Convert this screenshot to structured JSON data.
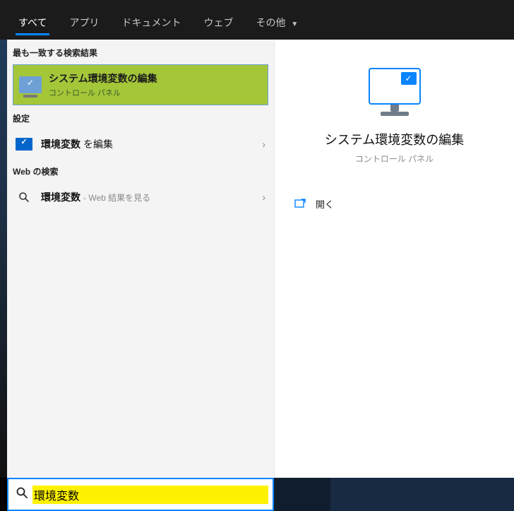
{
  "tabs": {
    "all": "すべて",
    "apps": "アプリ",
    "docs": "ドキュメント",
    "web": "ウェブ",
    "more": "その他"
  },
  "sections": {
    "best_match": "最も一致する検索結果",
    "settings": "設定",
    "web_search": "Web の検索"
  },
  "best_match": {
    "title": "システム環境変数の編集",
    "subtitle": "コントロール パネル"
  },
  "settings_item": {
    "prefix": "環境変数",
    "suffix": "を編集"
  },
  "web_item": {
    "prefix": "環境変数",
    "suffix": " - Web 結果を見る"
  },
  "preview": {
    "title": "システム環境変数の編集",
    "subtitle": "コントロール パネル",
    "open_label": "開く"
  },
  "search": {
    "value": "環境変数"
  }
}
